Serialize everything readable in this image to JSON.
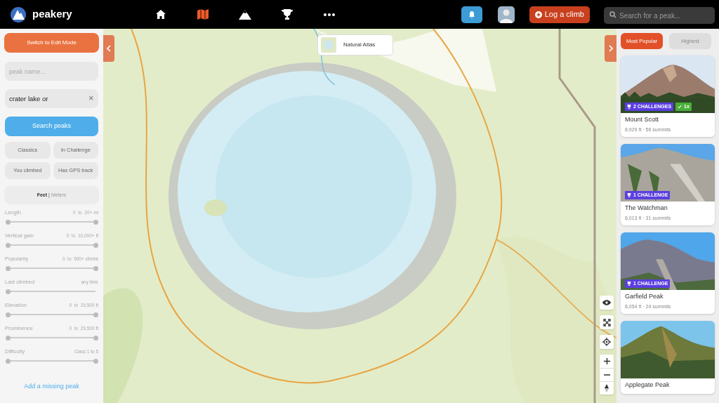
{
  "header": {
    "brand": "peakery",
    "nav": [
      {
        "kind": "home",
        "selected": false
      },
      {
        "kind": "map",
        "selected": true
      },
      {
        "kind": "mountain",
        "selected": false
      },
      {
        "kind": "trophy",
        "selected": false
      },
      {
        "kind": "more",
        "selected": false
      }
    ],
    "log_button": "Log a climb",
    "search": {
      "placeholder": "Search for a peak..."
    }
  },
  "sidebar": {
    "edit_button": "Switch to Edit Mode",
    "name_field": {
      "placeholder": "peak name..."
    },
    "location_field": {
      "value": "crater lake or",
      "clear": "✕"
    },
    "search_button": "Search peaks",
    "chips": [
      {
        "label": "Classics",
        "selected": false
      },
      {
        "label": "In Challenge",
        "selected": false
      },
      {
        "label": "You climbed",
        "selected": false
      },
      {
        "label": "Has GPS track",
        "selected": false
      }
    ],
    "units": [
      {
        "label": "Feet",
        "selected": true
      },
      {
        "label": "Meters",
        "selected": false
      }
    ],
    "unit_separator": "|",
    "filters": [
      {
        "kind": "range",
        "label": "Length",
        "reading": "0  to  20+ mi",
        "level": 1
      },
      {
        "kind": "range",
        "label": "Vertical gain",
        "reading": "0  to  10,000+ ft",
        "level": 1
      },
      {
        "kind": "range",
        "label": "Popularity",
        "reading": "0  to  500+ climbs",
        "level": 1
      },
      {
        "kind": "single",
        "label": "Last climbed",
        "reading": "any time",
        "level": 0
      },
      {
        "kind": "range",
        "label": "Elevation",
        "reading": "0  to  29,500 ft",
        "level": 1
      },
      {
        "kind": "range",
        "label": "Prominence",
        "reading": "0  to  29,500 ft",
        "level": 1
      },
      {
        "kind": "range",
        "label": "Difficulty",
        "reading": "Class 1 to 5",
        "level": 1
      }
    ],
    "add_link": "Add a missing peak"
  },
  "map": {
    "layer_button": "Natural Atlas"
  },
  "results": {
    "sort_tabs": [
      {
        "label": "Most Popular",
        "selected": true
      },
      {
        "label": "Highest",
        "selected": false
      }
    ],
    "cards": [
      {
        "name": "Mount Scott",
        "stats": "8,929 ft · 56 summits",
        "badges": [
          {
            "kind": "challenge",
            "label": "2 CHALLENGES"
          },
          {
            "kind": "climbed",
            "label": "1x"
          }
        ]
      },
      {
        "name": "The Watchman",
        "stats": "8,013 ft · 31 summits",
        "badges": [
          {
            "kind": "challenge",
            "label": "1 CHALLENGE"
          }
        ]
      },
      {
        "name": "Garfield Peak",
        "stats": "8,054 ft · 24 summits",
        "badges": [
          {
            "kind": "challenge",
            "label": "1 CHALLENGE"
          }
        ]
      },
      {
        "name": "Applegate Peak"
      }
    ]
  }
}
